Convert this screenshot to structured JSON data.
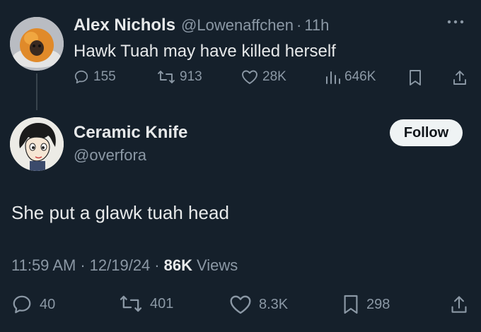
{
  "parent": {
    "name": "Alex Nichols",
    "handle": "@Lowenaffchen",
    "separator": "·",
    "time": "11h",
    "text": "Hawk Tuah may have killed herself",
    "stats": {
      "replies": "155",
      "reposts": "913",
      "likes": "28K",
      "views": "646K"
    }
  },
  "tweet": {
    "name": "Ceramic Knife",
    "handle": "@overfora",
    "follow_label": "Follow",
    "text": "She put a glawk tuah head",
    "time": "11:59 AM",
    "sep1": "·",
    "date": "12/19/24",
    "sep2": "·",
    "views_count": "86K",
    "views_label": "Views",
    "stats": {
      "replies": "40",
      "reposts": "401",
      "likes": "8.3K",
      "bookmarks": "298"
    }
  },
  "colors": {
    "background": "#15202b",
    "primary_text": "#e7e9ea",
    "secondary_text": "#8b98a5",
    "thread_line": "#38444d",
    "follow_button_bg": "#eff3f4"
  },
  "icons": [
    "reply-icon",
    "repost-icon",
    "like-icon",
    "views-icon",
    "bookmark-icon",
    "share-icon",
    "more-icon"
  ]
}
